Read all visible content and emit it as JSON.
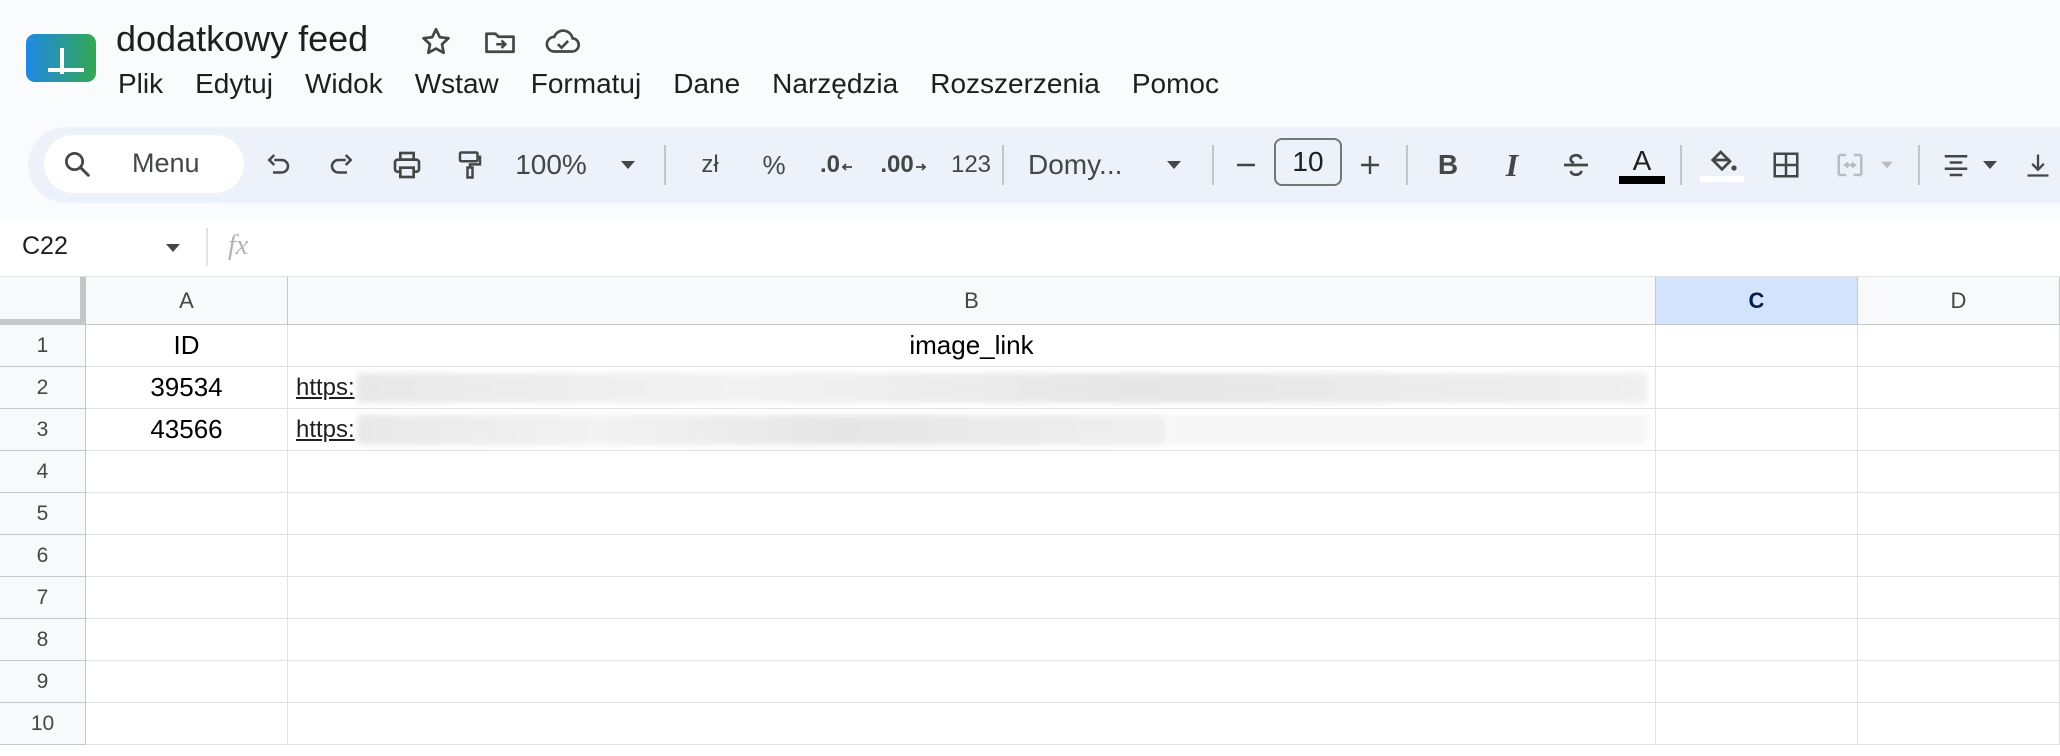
{
  "app": {
    "title": "dodatkowy feed",
    "icons": [
      "star-icon",
      "move-to-folder-icon",
      "cloud-saved-icon"
    ],
    "brand_color": "#0f9d58"
  },
  "menu": [
    "Plik",
    "Edytuj",
    "Widok",
    "Wstaw",
    "Formatuj",
    "Dane",
    "Narzędzia",
    "Rozszerzenia",
    "Pomoc"
  ],
  "toolbar": {
    "search_label": "Menu",
    "zoom": "100%",
    "currency": "zł",
    "percent": "%",
    "decrease_decimals": ".0",
    "increase_decimals": ".00",
    "number_format": "123",
    "font": "Domy...",
    "font_size": "10",
    "decrease_size": "–",
    "increase_size": "+",
    "bold": "B",
    "italic": "I",
    "text_color": "A"
  },
  "formula_bar": {
    "cell_ref": "C22",
    "fx": "fx",
    "value": ""
  },
  "sheet": {
    "columns": [
      "A",
      "B",
      "C",
      "D"
    ],
    "selected_column": "C",
    "rows": [
      "1",
      "2",
      "3",
      "4",
      "5",
      "6",
      "7",
      "8",
      "9",
      "10"
    ],
    "cells": {
      "A1": "ID",
      "B1": "image_link",
      "A2": "39534",
      "B2": "https:",
      "A3": "43566",
      "B3": "https:"
    }
  }
}
